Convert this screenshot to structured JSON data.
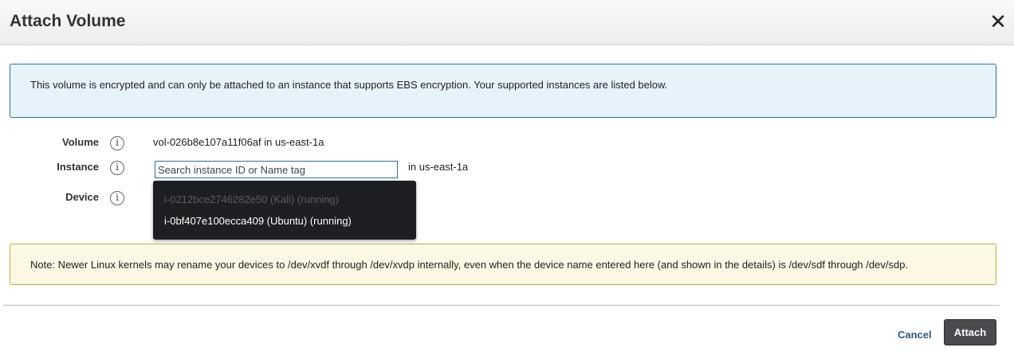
{
  "dialog": {
    "title": "Attach Volume",
    "close_glyph": "✕"
  },
  "info_banner": {
    "text": "This volume is encrypted and can only be attached to an instance that supports EBS encryption. Your supported instances are listed below."
  },
  "form": {
    "info_glyph": "i",
    "volume": {
      "label": "Volume",
      "value": "vol-026b8e107a11f06af in us-east-1a"
    },
    "instance": {
      "label": "Instance",
      "placeholder": "Search instance ID or Name tag",
      "value": "",
      "zone": "in us-east-1a",
      "options": [
        {
          "text": "i-0212bce2746282e50 (Kali) (running)",
          "enabled": false
        },
        {
          "text": "i-0bf407e100ecca409 (Ubuntu) (running)",
          "enabled": true
        }
      ]
    },
    "device": {
      "label": "Device"
    }
  },
  "note": {
    "text": "Note: Newer Linux kernels may rename your devices to /dev/xvdf through /dev/xvdp internally, even when the device name entered here (and shown in the details) is /dev/sdf through /dev/sdp."
  },
  "footer": {
    "cancel_label": "Cancel",
    "attach_label": "Attach"
  },
  "colors": {
    "info_border": "#2f6f9f",
    "info_bg": "#e6f3fb",
    "note_bg": "#fdf8e3",
    "note_border": "#c9a84d",
    "primary_button": "#4a4a4f",
    "link": "#2b5c85",
    "dropdown_bg": "#1e1f23"
  }
}
